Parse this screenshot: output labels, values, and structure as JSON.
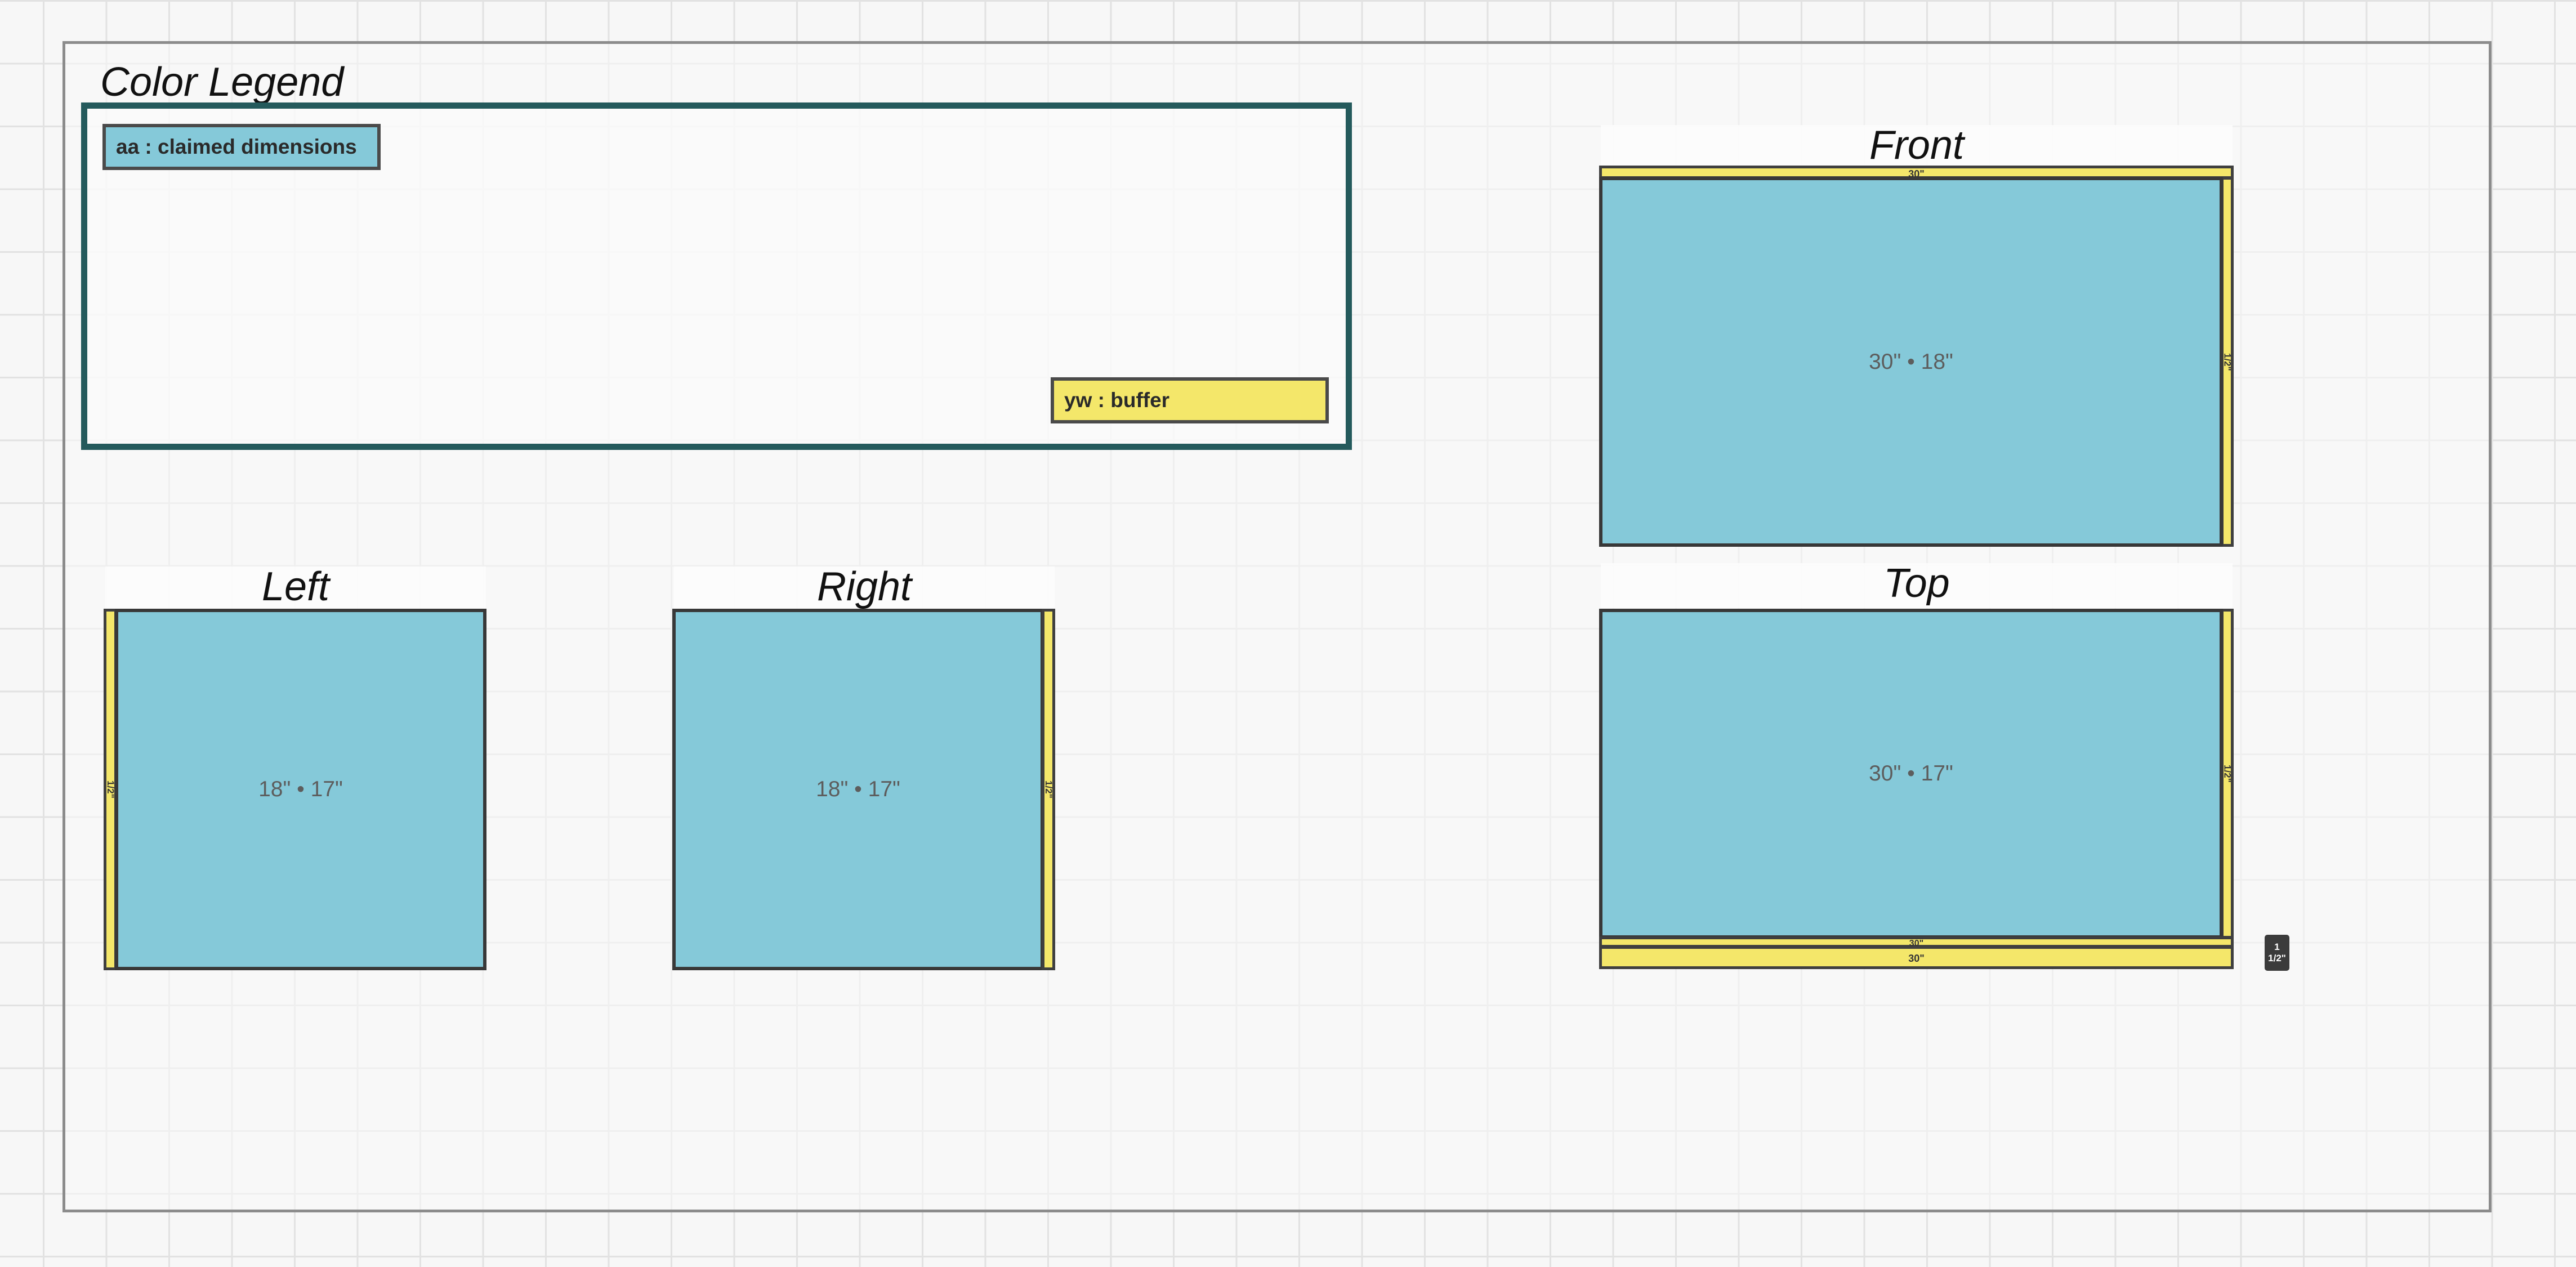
{
  "legend": {
    "title": "Color Legend",
    "items": [
      {
        "key": "aa",
        "label": "aa : claimed dimensions",
        "color": "#85c9d9"
      },
      {
        "key": "yw",
        "label": "yw : buffer",
        "color": "#f4e76a"
      }
    ],
    "frame_color": "#245a5c"
  },
  "views": {
    "front": {
      "title": "Front",
      "dimension": "30\" • 18\"",
      "buffer_top": "30\"",
      "buffer_side": "1/2\""
    },
    "top": {
      "title": "Top",
      "dimension": "30\" • 17\"",
      "buffer_side": "1/2\"",
      "buffer_bottom_1": "30\"",
      "buffer_bottom_2": "30\"",
      "corner_badge_line1": "1",
      "corner_badge_line2": "1/2\""
    },
    "left": {
      "title": "Left",
      "dimension": "18\" • 17\"",
      "buffer_side": "1/2\""
    },
    "right": {
      "title": "Right",
      "dimension": "18\" • 17\"",
      "buffer_side": "1/2\""
    }
  },
  "colors": {
    "claimed": "#85c9d9",
    "buffer": "#f4e76a",
    "background": "#f7f7f7"
  }
}
